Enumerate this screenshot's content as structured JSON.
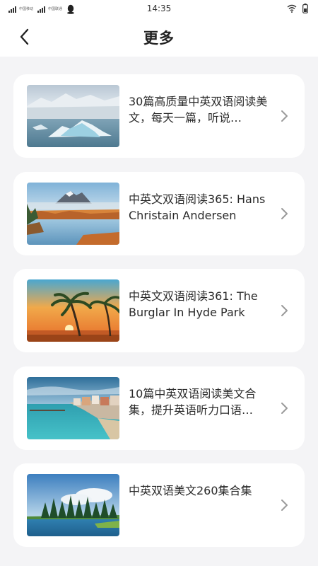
{
  "status": {
    "time": "14:35",
    "carrier1": "中国移动",
    "carrier2": "中国联通"
  },
  "header": {
    "title": "更多"
  },
  "items": [
    {
      "title": "30篇高质量中英双语阅读美文，每天一篇，听说…",
      "image": "glacier"
    },
    {
      "title": "中英文双语阅读365: Hans Christain Andersen",
      "image": "mountain-lake"
    },
    {
      "title": "中英文双语阅读361: The Burglar In Hyde Park",
      "image": "palm-sunset"
    },
    {
      "title": "10篇中英双语阅读美文合集，提升英语听力口语…",
      "image": "coastal-town"
    },
    {
      "title": "中英双语美文260集合集",
      "image": "forest-lake"
    }
  ]
}
